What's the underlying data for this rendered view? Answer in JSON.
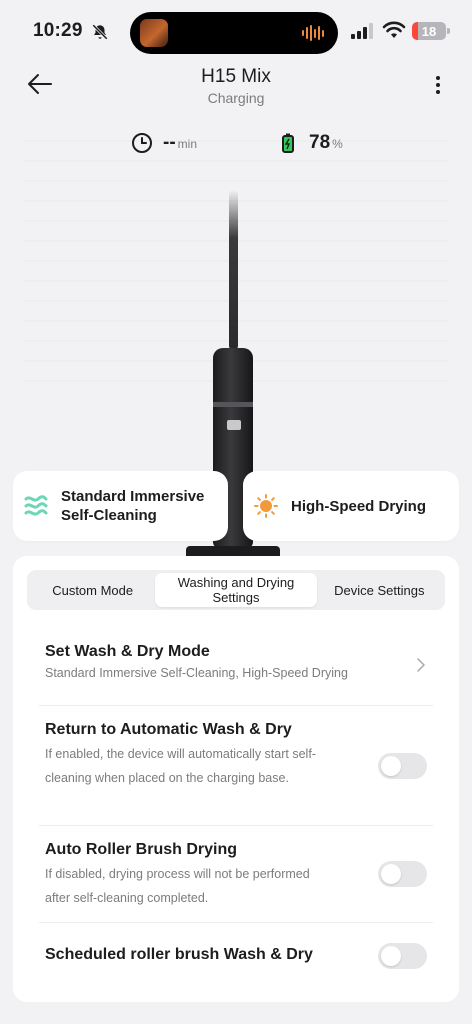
{
  "status_bar": {
    "time": "10:29",
    "battery_text": "18",
    "battery_level_percent": 18,
    "icons": [
      "bell-slash-icon",
      "signal-bars-icon",
      "wifi-icon",
      "battery-icon"
    ]
  },
  "header": {
    "title": "H15 Mix",
    "subtitle": "Charging",
    "icons": [
      "back-arrow-icon",
      "more-vertical-icon"
    ]
  },
  "device": {
    "time_value": "--",
    "time_unit": "min",
    "battery_value": "78",
    "battery_unit": "%"
  },
  "modes": [
    {
      "label": "Standard Immersive Self-Cleaning",
      "icon": "wave-icon",
      "color": "#6dd6b5"
    },
    {
      "label": "High-Speed Drying",
      "icon": "sun-icon",
      "color": "#f29a3b"
    }
  ],
  "tabs": [
    {
      "label": "Custom Mode"
    },
    {
      "label": "Washing and Drying Settings",
      "active": true
    },
    {
      "label": "Device Settings"
    }
  ],
  "settings": {
    "wash_dry_mode": {
      "title": "Set Wash & Dry Mode",
      "value": "Standard Immersive Self-Cleaning, High-Speed Drying"
    },
    "auto_return": {
      "title": "Return to Automatic Wash & Dry",
      "desc": "If enabled, the device will automatically start self-cleaning when placed on the charging base.",
      "enabled": false
    },
    "auto_roller_drying": {
      "title": "Auto Roller Brush Drying",
      "desc": "If disabled, drying process will not be performed after self-cleaning completed.",
      "enabled": false
    },
    "scheduled_wash_dry": {
      "title": "Scheduled roller brush Wash & Dry",
      "enabled": false
    }
  },
  "colors": {
    "accent_wave": "#6dd6b5",
    "accent_sun": "#f29a3b",
    "battery_green": "#34c759",
    "status_battery_low": "#ff453a"
  }
}
